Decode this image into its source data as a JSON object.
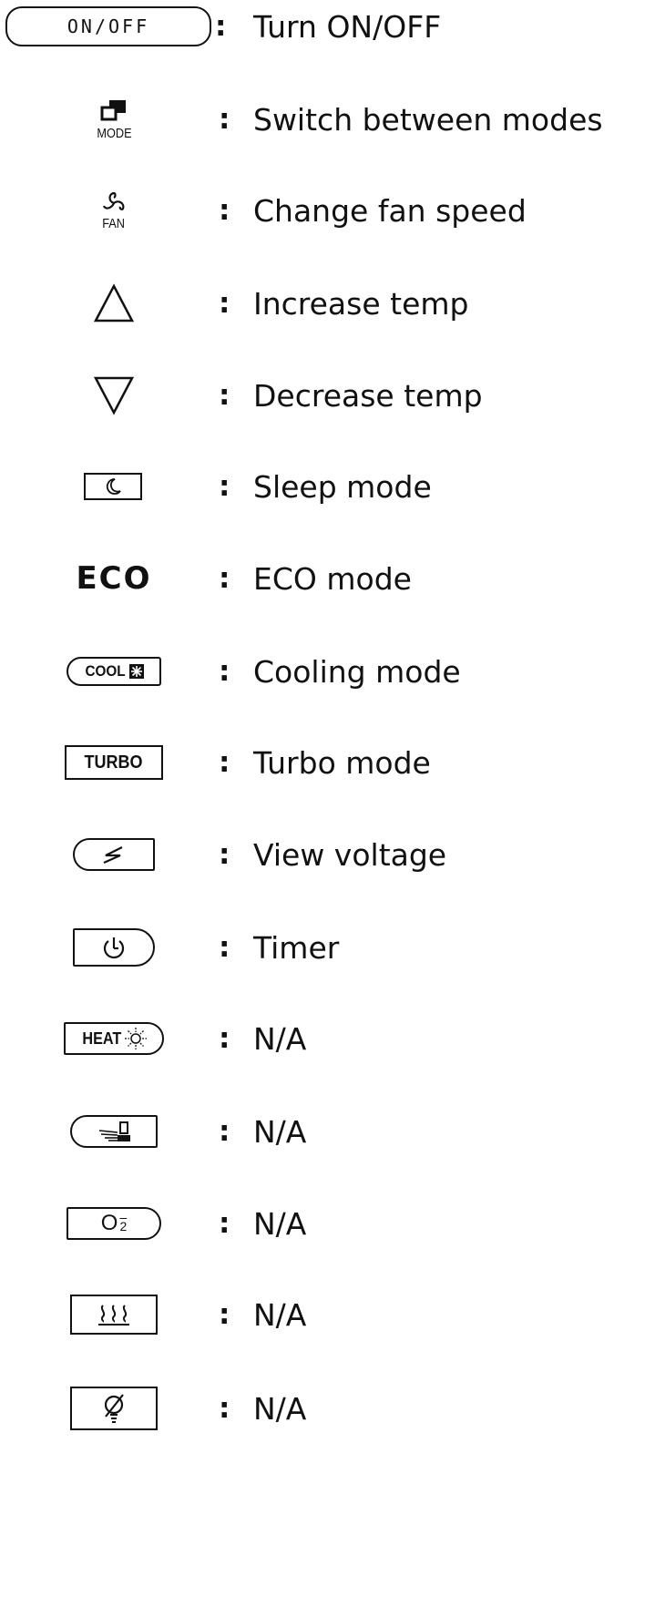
{
  "rows": [
    {
      "icon": "onoff-button-icon",
      "label": "ON/OFF",
      "desc": "Turn ON/OFF"
    },
    {
      "icon": "mode-icon",
      "label": "MODE",
      "desc": "Switch between modes"
    },
    {
      "icon": "fan-icon",
      "label": "FAN",
      "desc": "Change fan speed"
    },
    {
      "icon": "triangle-up-icon",
      "desc": "Increase temp"
    },
    {
      "icon": "triangle-down-icon",
      "desc": "Decrease temp"
    },
    {
      "icon": "moon-icon",
      "desc": "Sleep mode"
    },
    {
      "icon": "eco-icon",
      "label": "ECO",
      "desc": "ECO mode"
    },
    {
      "icon": "cool-snowflake-icon",
      "label": "COOL",
      "desc": "Cooling mode"
    },
    {
      "icon": "turbo-icon",
      "label": "TURBO",
      "desc": "Turbo mode"
    },
    {
      "icon": "lightning-icon",
      "desc": "View voltage"
    },
    {
      "icon": "timer-icon",
      "desc": "Timer"
    },
    {
      "icon": "heat-sun-icon",
      "label": "HEAT",
      "desc": "N/A"
    },
    {
      "icon": "swing-icon",
      "desc": "N/A"
    },
    {
      "icon": "o2-icon",
      "label": "O",
      "sub": "2",
      "desc": "N/A"
    },
    {
      "icon": "heater-waves-icon",
      "desc": "N/A"
    },
    {
      "icon": "no-light-icon",
      "desc": "N/A"
    }
  ],
  "colon": ":"
}
